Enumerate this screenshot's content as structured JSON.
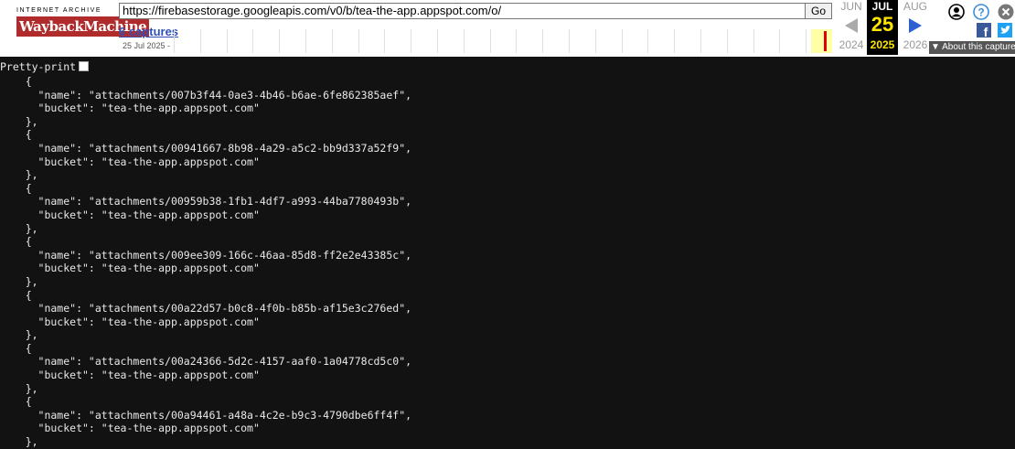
{
  "wayback": {
    "logo_top": "INTERNET ARCHIVE",
    "logo_main": "WaybackMachine",
    "url": "https://firebasestorage.googleapis.com/v0/b/tea-the-app.appspot.com/o/",
    "go_label": "Go",
    "captures_label": "6 captures",
    "captures_date": "25 Jul 2025 -",
    "prev": {
      "month": "JUN",
      "year": "2024"
    },
    "current": {
      "month": "JUL",
      "day": "25",
      "year": "2025"
    },
    "next": {
      "month": "AUG",
      "year": "2026"
    },
    "about_label": "About this capture",
    "colors": {
      "logo_red": "#b02b2b",
      "highlight_yellow": "#ffe600",
      "link_blue": "#2f4fb4",
      "arrow_blue": "#2f5fd0"
    }
  },
  "pretty_print": {
    "label": "Pretty-print",
    "checked": false
  },
  "records": [
    {
      "name": "attachments/007b3f44-0ae3-4b46-b6ae-6fe862385aef",
      "bucket": "tea-the-app.appspot.com"
    },
    {
      "name": "attachments/00941667-8b98-4a29-a5c2-bb9d337a52f9",
      "bucket": "tea-the-app.appspot.com"
    },
    {
      "name": "attachments/00959b38-1fb1-4df7-a993-44ba7780493b",
      "bucket": "tea-the-app.appspot.com"
    },
    {
      "name": "attachments/009ee309-166c-46aa-85d8-ff2e2e43385c",
      "bucket": "tea-the-app.appspot.com"
    },
    {
      "name": "attachments/00a22d57-b0c8-4f0b-b85b-af15e3c276ed",
      "bucket": "tea-the-app.appspot.com"
    },
    {
      "name": "attachments/00a24366-5d2c-4157-aaf0-1a04778cd5c0",
      "bucket": "tea-the-app.appspot.com"
    },
    {
      "name": "attachments/00a94461-a48a-4c2e-b9c3-4790dbe6ff4f",
      "bucket": "tea-the-app.appspot.com"
    }
  ]
}
